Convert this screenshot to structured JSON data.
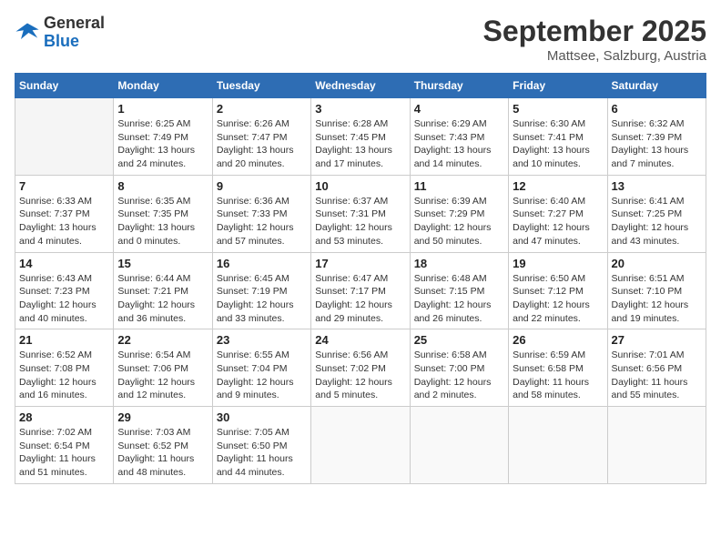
{
  "header": {
    "logo_general": "General",
    "logo_blue": "Blue",
    "month_title": "September 2025",
    "location": "Mattsee, Salzburg, Austria"
  },
  "days_of_week": [
    "Sunday",
    "Monday",
    "Tuesday",
    "Wednesday",
    "Thursday",
    "Friday",
    "Saturday"
  ],
  "weeks": [
    [
      {
        "day": "",
        "info": ""
      },
      {
        "day": "1",
        "info": "Sunrise: 6:25 AM\nSunset: 7:49 PM\nDaylight: 13 hours\nand 24 minutes."
      },
      {
        "day": "2",
        "info": "Sunrise: 6:26 AM\nSunset: 7:47 PM\nDaylight: 13 hours\nand 20 minutes."
      },
      {
        "day": "3",
        "info": "Sunrise: 6:28 AM\nSunset: 7:45 PM\nDaylight: 13 hours\nand 17 minutes."
      },
      {
        "day": "4",
        "info": "Sunrise: 6:29 AM\nSunset: 7:43 PM\nDaylight: 13 hours\nand 14 minutes."
      },
      {
        "day": "5",
        "info": "Sunrise: 6:30 AM\nSunset: 7:41 PM\nDaylight: 13 hours\nand 10 minutes."
      },
      {
        "day": "6",
        "info": "Sunrise: 6:32 AM\nSunset: 7:39 PM\nDaylight: 13 hours\nand 7 minutes."
      }
    ],
    [
      {
        "day": "7",
        "info": "Sunrise: 6:33 AM\nSunset: 7:37 PM\nDaylight: 13 hours\nand 4 minutes."
      },
      {
        "day": "8",
        "info": "Sunrise: 6:35 AM\nSunset: 7:35 PM\nDaylight: 13 hours\nand 0 minutes."
      },
      {
        "day": "9",
        "info": "Sunrise: 6:36 AM\nSunset: 7:33 PM\nDaylight: 12 hours\nand 57 minutes."
      },
      {
        "day": "10",
        "info": "Sunrise: 6:37 AM\nSunset: 7:31 PM\nDaylight: 12 hours\nand 53 minutes."
      },
      {
        "day": "11",
        "info": "Sunrise: 6:39 AM\nSunset: 7:29 PM\nDaylight: 12 hours\nand 50 minutes."
      },
      {
        "day": "12",
        "info": "Sunrise: 6:40 AM\nSunset: 7:27 PM\nDaylight: 12 hours\nand 47 minutes."
      },
      {
        "day": "13",
        "info": "Sunrise: 6:41 AM\nSunset: 7:25 PM\nDaylight: 12 hours\nand 43 minutes."
      }
    ],
    [
      {
        "day": "14",
        "info": "Sunrise: 6:43 AM\nSunset: 7:23 PM\nDaylight: 12 hours\nand 40 minutes."
      },
      {
        "day": "15",
        "info": "Sunrise: 6:44 AM\nSunset: 7:21 PM\nDaylight: 12 hours\nand 36 minutes."
      },
      {
        "day": "16",
        "info": "Sunrise: 6:45 AM\nSunset: 7:19 PM\nDaylight: 12 hours\nand 33 minutes."
      },
      {
        "day": "17",
        "info": "Sunrise: 6:47 AM\nSunset: 7:17 PM\nDaylight: 12 hours\nand 29 minutes."
      },
      {
        "day": "18",
        "info": "Sunrise: 6:48 AM\nSunset: 7:15 PM\nDaylight: 12 hours\nand 26 minutes."
      },
      {
        "day": "19",
        "info": "Sunrise: 6:50 AM\nSunset: 7:12 PM\nDaylight: 12 hours\nand 22 minutes."
      },
      {
        "day": "20",
        "info": "Sunrise: 6:51 AM\nSunset: 7:10 PM\nDaylight: 12 hours\nand 19 minutes."
      }
    ],
    [
      {
        "day": "21",
        "info": "Sunrise: 6:52 AM\nSunset: 7:08 PM\nDaylight: 12 hours\nand 16 minutes."
      },
      {
        "day": "22",
        "info": "Sunrise: 6:54 AM\nSunset: 7:06 PM\nDaylight: 12 hours\nand 12 minutes."
      },
      {
        "day": "23",
        "info": "Sunrise: 6:55 AM\nSunset: 7:04 PM\nDaylight: 12 hours\nand 9 minutes."
      },
      {
        "day": "24",
        "info": "Sunrise: 6:56 AM\nSunset: 7:02 PM\nDaylight: 12 hours\nand 5 minutes."
      },
      {
        "day": "25",
        "info": "Sunrise: 6:58 AM\nSunset: 7:00 PM\nDaylight: 12 hours\nand 2 minutes."
      },
      {
        "day": "26",
        "info": "Sunrise: 6:59 AM\nSunset: 6:58 PM\nDaylight: 11 hours\nand 58 minutes."
      },
      {
        "day": "27",
        "info": "Sunrise: 7:01 AM\nSunset: 6:56 PM\nDaylight: 11 hours\nand 55 minutes."
      }
    ],
    [
      {
        "day": "28",
        "info": "Sunrise: 7:02 AM\nSunset: 6:54 PM\nDaylight: 11 hours\nand 51 minutes."
      },
      {
        "day": "29",
        "info": "Sunrise: 7:03 AM\nSunset: 6:52 PM\nDaylight: 11 hours\nand 48 minutes."
      },
      {
        "day": "30",
        "info": "Sunrise: 7:05 AM\nSunset: 6:50 PM\nDaylight: 11 hours\nand 44 minutes."
      },
      {
        "day": "",
        "info": ""
      },
      {
        "day": "",
        "info": ""
      },
      {
        "day": "",
        "info": ""
      },
      {
        "day": "",
        "info": ""
      }
    ]
  ]
}
